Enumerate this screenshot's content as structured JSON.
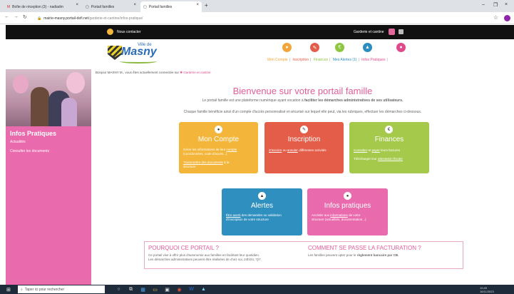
{
  "browser": {
    "tabs": [
      {
        "icon": "gmail-icon",
        "label": "Boîte de réception (3) - nadiadm",
        "active": false
      },
      {
        "icon": "page-icon",
        "label": "Portail familles",
        "active": false
      },
      {
        "icon": "page-icon",
        "label": "Portail familles",
        "active": true
      }
    ],
    "url_domain": "mairie-masny.portail-defi.net",
    "url_path": "/garderie-et-cantine/infos-pratique/"
  },
  "topbar": {
    "contact": "Nous contacter",
    "service": "Garderie et cantine"
  },
  "logo": {
    "ville": "Ville de",
    "name": "Masny"
  },
  "topnav": {
    "colors": [
      "#f3a53a",
      "#e35d49",
      "#8dc63f",
      "#2b8ebf",
      "#e2498a"
    ],
    "items": [
      {
        "label": "Mon Compte",
        "color": "#f3a53a",
        "icon": "user-icon",
        "glyph": "●"
      },
      {
        "label": "Inscription",
        "color": "#e35d49",
        "icon": "pencil-icon",
        "glyph": "✎"
      },
      {
        "label": "Finances",
        "color": "#8dc63f",
        "icon": "euro-icon",
        "glyph": "€"
      },
      {
        "label": "Mes Alertes (1)",
        "color": "#2b8ebf",
        "icon": "alert-icon",
        "glyph": "▲"
      },
      {
        "label": "Infos Pratiques",
        "color": "#e2498a",
        "icon": "speech-icon",
        "glyph": "●"
      }
    ]
  },
  "sidebar": {
    "title": "Infos Pratiques",
    "links": [
      "Actualités",
      "Consulter les documents"
    ]
  },
  "main": {
    "greeting_prefix": "Bonjour MASNY M., vous êtes actuellement connectée sur",
    "greeting_service": "Garderie et cantine",
    "title": "Bienvenue sur votre portail famille",
    "intro1_a": "Le portail famille est une plateforme numérique ayant vocation à",
    "intro1_b": "faciliter les démarches administratives de ses utilisateurs.",
    "intro2": "Chaque famille bénéficie ainsi d'un compte d'accès personnalisé et sécurisé sur lequel elle peut, via les rubriques, effectuer les démarches ci-dessous."
  },
  "cards": {
    "compte": {
      "title": "Mon Compte",
      "glyph": "●",
      "l1": "Gérer les informations de leur",
      "l1u": "compte",
      "l2": "(coordonnées, code d'accès...)",
      "l3u": "Transmettre des documents",
      "l3": "à la",
      "l4": "structure",
      "color": "#f3b63a"
    },
    "inscription": {
      "title": "Inscription",
      "glyph": "✎",
      "u1": "S'inscrire",
      "t1": "ou",
      "u2": "annuler",
      "t2": "différentes activités",
      "color": "#e35d49"
    },
    "finances": {
      "title": "Finances",
      "glyph": "€",
      "u1": "Consulter",
      "t1": "et",
      "u2": "payer",
      "t2": "leurs factures",
      "t3": "Télécharger leur",
      "u3": "attestation fiscale",
      "color": "#a5c94a"
    },
    "alertes": {
      "title": "Alertes",
      "glyph": "▲",
      "u1": "Être averti",
      "t1": "des demandes ou validation",
      "t2": "d'inscription de votre structure",
      "color": "#2f8fbf"
    },
    "infos": {
      "title": "Infos pratiques",
      "glyph": "●",
      "t1": "Accéder aux",
      "u1": "informations",
      "t2": "de votre",
      "t3": "structure (actualités, documentation...)",
      "color": "#ea6bad"
    }
  },
  "info": {
    "left_title": "POURQUOI CE PORTAIL ?",
    "left_l1": "Ce portail vise à offrir plus d'autonomie aux familles en facilitant leur quotidien.",
    "left_l2": "Les démarches administratives peuvent être réalisées de chez soi, 24h/24, 7j/7.",
    "right_title": "COMMENT SE PASSE LA FACTURATION ?",
    "right_l1": "Les familles peuvent opter pour le",
    "right_l1b": "règlement bancaire par CB."
  },
  "taskbar": {
    "search": "Taper ici pour rechercher",
    "time": "10:49",
    "date": "16/11/2023"
  }
}
